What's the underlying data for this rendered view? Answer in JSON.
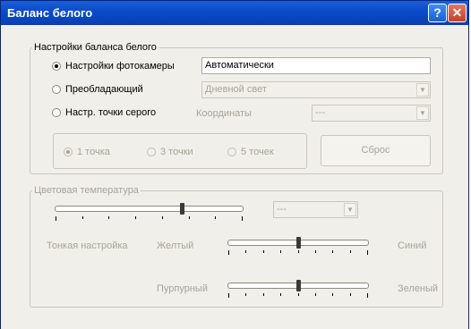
{
  "title": "Баланс белого",
  "title_buttons": {
    "help": "?",
    "close": "✕"
  },
  "wb_group": {
    "legend": "Настройки баланса белого",
    "camera": {
      "label": "Настройки фотокамеры",
      "value": "Автоматически",
      "selected": true
    },
    "dominant": {
      "label": "Преобладающий",
      "value": "Дневной свет"
    },
    "gray_point": {
      "label": "Настр. точки серого",
      "coords_label": "Координаты",
      "coords_value": "---"
    },
    "points": [
      {
        "label": "1 точка",
        "selected": true
      },
      {
        "label": "3 точки",
        "selected": false
      },
      {
        "label": "5 точек",
        "selected": false
      }
    ],
    "reset_label": "Сброс"
  },
  "color_temp": {
    "legend": "Цветовая температура",
    "value": "---",
    "fine_tune_label": "Тонкая настройка",
    "yellow_label": "Желтый",
    "blue_label": "Синий",
    "magenta_label": "Пурпурный",
    "green_label": "Зеленый",
    "temp_level": 0.68,
    "yellow_blue_level": 0.5,
    "magenta_green_level": 0.5
  },
  "icons": {
    "dropdown": "dropdown-arrow-icon",
    "help": "help-icon",
    "close": "close-icon"
  }
}
